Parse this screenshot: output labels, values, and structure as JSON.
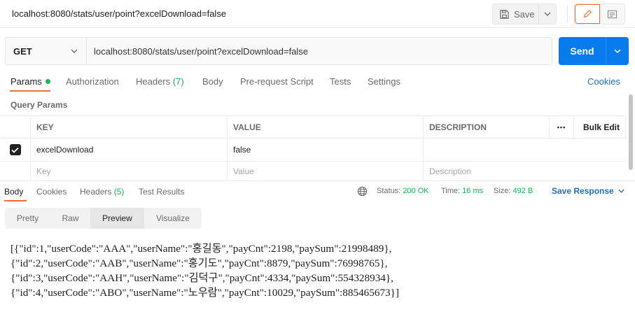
{
  "request": {
    "title": "localhost:8080/stats/user/point?excelDownload=false",
    "method": "GET",
    "url": "localhost:8080/stats/user/point?excelDownload=false"
  },
  "toolbar": {
    "save_label": "Save",
    "send_label": "Send"
  },
  "request_tabs": {
    "params": "Params",
    "authorization": "Authorization",
    "headers": "Headers",
    "headers_count": "(7)",
    "body": "Body",
    "prerequest": "Pre-request Script",
    "tests": "Tests",
    "settings": "Settings",
    "cookies": "Cookies"
  },
  "params": {
    "section_label": "Query Params",
    "columns": {
      "key": "KEY",
      "value": "VALUE",
      "description": "DESCRIPTION",
      "more": "•••",
      "bulk_edit": "Bulk Edit"
    },
    "rows": [
      {
        "checked": true,
        "key": "excelDownload",
        "value": "false",
        "description": ""
      }
    ],
    "placeholder": {
      "key": "Key",
      "value": "Value",
      "description": "Description"
    }
  },
  "response_tabs": {
    "body": "Body",
    "cookies": "Cookies",
    "headers": "Headers",
    "headers_count": "(5)",
    "test_results": "Test Results"
  },
  "response_status": {
    "status_label": "Status:",
    "status_value": "200 OK",
    "time_label": "Time:",
    "time_value": "16 ms",
    "size_label": "Size:",
    "size_value": "492 B",
    "save_response": "Save Response"
  },
  "view_tabs": [
    "Pretty",
    "Raw",
    "Preview",
    "Visualize"
  ],
  "view_tabs_active": "Preview",
  "preview_lines": [
    "[{\"id\":1,\"userCode\":\"AAA\",\"userName\":\"홍길동\",\"payCnt\":2198,\"paySum\":21998489},",
    "{\"id\":2,\"userCode\":\"AAB\",\"userName\":\"홍기도\",\"payCnt\":8879,\"paySum\":76998765},",
    "{\"id\":3,\"userCode\":\"AAH\",\"userName\":\"김덕구\",\"payCnt\":4334,\"paySum\":554328934},",
    "{\"id\":4,\"userCode\":\"ABO\",\"userName\":\"노우람\",\"payCnt\":10029,\"paySum\":885465673}]"
  ],
  "colors": {
    "accent": "#f26b3a",
    "send": "#097bed",
    "success": "#0cbb52",
    "link": "#1a6fc2"
  },
  "icons": {
    "save": "floppy-disk-icon",
    "edit": "pencil-icon",
    "docs": "document-icon",
    "network": "globe-icon"
  }
}
